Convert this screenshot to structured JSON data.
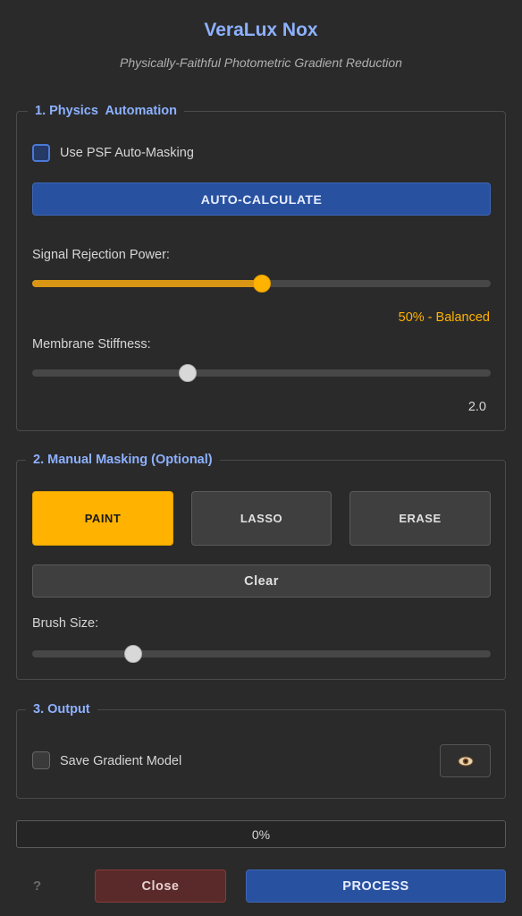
{
  "header": {
    "title": "VeraLux Nox",
    "subtitle": "Physically-Faithful Photometric Gradient Reduction"
  },
  "physics": {
    "group_title": "1. Physics  Automation",
    "psf_checkbox_label": "Use PSF Auto-Masking",
    "psf_checked": false,
    "auto_calc_label": "AUTO-CALCULATE",
    "signal_rejection": {
      "label": "Signal Rejection Power:",
      "value_percent": 50,
      "value_text": "50% - Balanced"
    },
    "membrane": {
      "label": "Membrane Stiffness:",
      "level": 0.34,
      "value_text": "2.0"
    }
  },
  "masking": {
    "group_title": "2. Manual Masking (Optional)",
    "paint_label": "PAINT",
    "lasso_label": "LASSO",
    "erase_label": "ERASE",
    "active_tool": "PAINT",
    "clear_label": "Clear",
    "brush": {
      "label": "Brush Size:",
      "level": 0.22
    }
  },
  "output": {
    "group_title": "3. Output",
    "save_gradient_label": "Save Gradient Model",
    "save_gradient_checked": false,
    "preview_icon": "eye-icon"
  },
  "progress": {
    "value_percent": 0,
    "text": "0%"
  },
  "footer": {
    "help_label": "?",
    "close_label": "Close",
    "process_label": "PROCESS"
  },
  "colors": {
    "accent_blue": "#8db1ff",
    "amber": "#ffb300",
    "button_blue": "#2851a0"
  }
}
